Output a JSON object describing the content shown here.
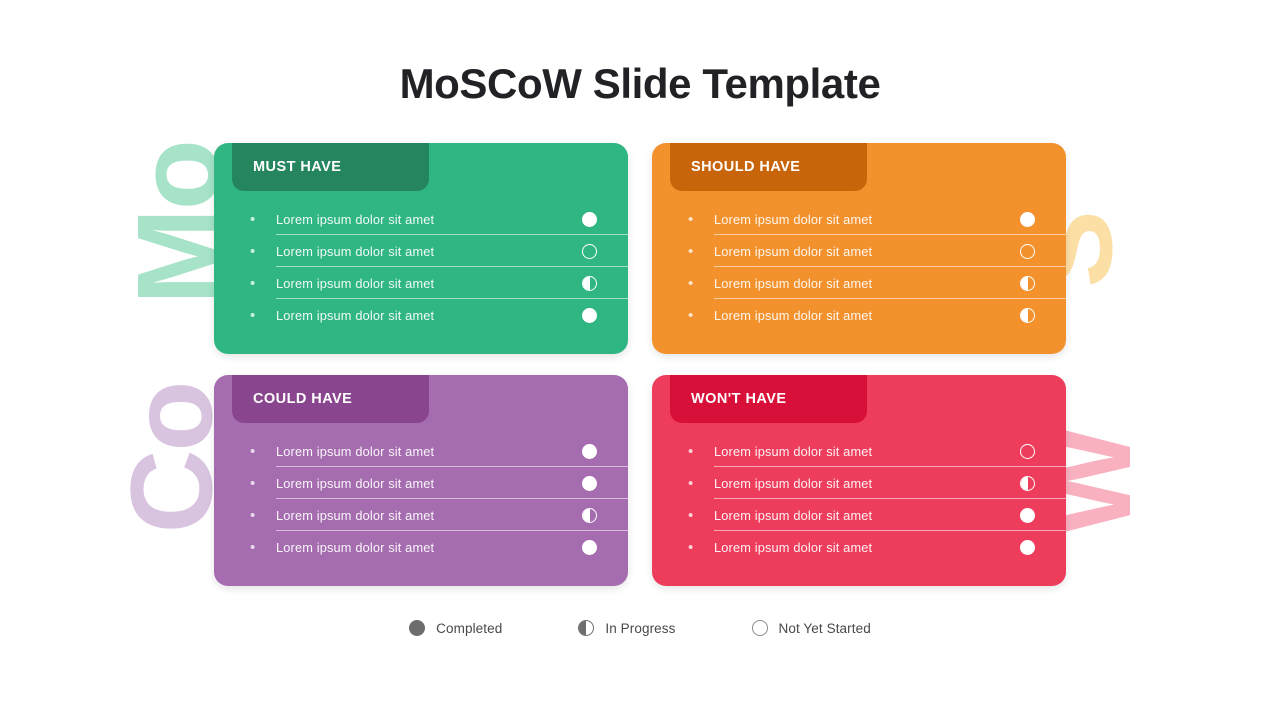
{
  "slide": {
    "title": "MoSCoW Slide Template",
    "background": "#ffffff",
    "title_color": "#222226"
  },
  "decorations": [
    {
      "text": "Mo",
      "color": "#a6e3c8"
    },
    {
      "text": "S",
      "color": "#fbdfa5"
    },
    {
      "text": "Co",
      "color": "#d9c4e0"
    },
    {
      "text": "W",
      "color": "#f9b1bf"
    }
  ],
  "quadrants": [
    {
      "id": "must-have",
      "title": "MUST HAVE",
      "body_color": "#2fb683",
      "header_color": "#24855f",
      "items": [
        {
          "text": "Lorem ipsum dolor sit amet",
          "status": "completed"
        },
        {
          "text": "Lorem ipsum dolor sit amet",
          "status": "notstarted"
        },
        {
          "text": "Lorem ipsum dolor sit amet",
          "status": "inprogress"
        },
        {
          "text": "Lorem ipsum dolor sit amet",
          "status": "completed"
        }
      ]
    },
    {
      "id": "should-have",
      "title": "SHOULD HAVE",
      "body_color": "#f3912c",
      "header_color": "#c8650a",
      "items": [
        {
          "text": "Lorem ipsum dolor sit amet",
          "status": "completed"
        },
        {
          "text": "Lorem ipsum dolor sit amet",
          "status": "notstarted"
        },
        {
          "text": "Lorem ipsum dolor sit amet",
          "status": "inprogress"
        },
        {
          "text": "Lorem ipsum dolor sit amet",
          "status": "inprogress"
        }
      ]
    },
    {
      "id": "could-have",
      "title": "COULD HAVE",
      "body_color": "#a56cb0",
      "header_color": "#89468e",
      "items": [
        {
          "text": "Lorem ipsum dolor sit amet",
          "status": "completed"
        },
        {
          "text": "Lorem ipsum dolor sit amet",
          "status": "completed"
        },
        {
          "text": "Lorem ipsum dolor sit amet",
          "status": "inprogress"
        },
        {
          "text": "Lorem ipsum dolor sit amet",
          "status": "completed"
        }
      ]
    },
    {
      "id": "wont-have",
      "title": "WON'T HAVE",
      "body_color": "#ee3d5c",
      "header_color": "#d80f38",
      "items": [
        {
          "text": "Lorem ipsum dolor sit amet",
          "status": "notstarted"
        },
        {
          "text": "Lorem ipsum dolor sit amet",
          "status": "inprogress"
        },
        {
          "text": "Lorem ipsum dolor sit amet",
          "status": "completed"
        },
        {
          "text": "Lorem ipsum dolor sit amet",
          "status": "completed"
        }
      ]
    }
  ],
  "legend": {
    "items": [
      {
        "label": "Completed",
        "status": "completed",
        "icon": "filled-circle-icon"
      },
      {
        "label": "In Progress",
        "status": "inprogress",
        "icon": "half-filled-circle-icon"
      },
      {
        "label": "Not Yet Started",
        "status": "notstarted",
        "icon": "empty-circle-icon"
      }
    ],
    "mark_color": "#6d6d6d",
    "text_color": "#49494d"
  },
  "bullet_glyph": "•"
}
